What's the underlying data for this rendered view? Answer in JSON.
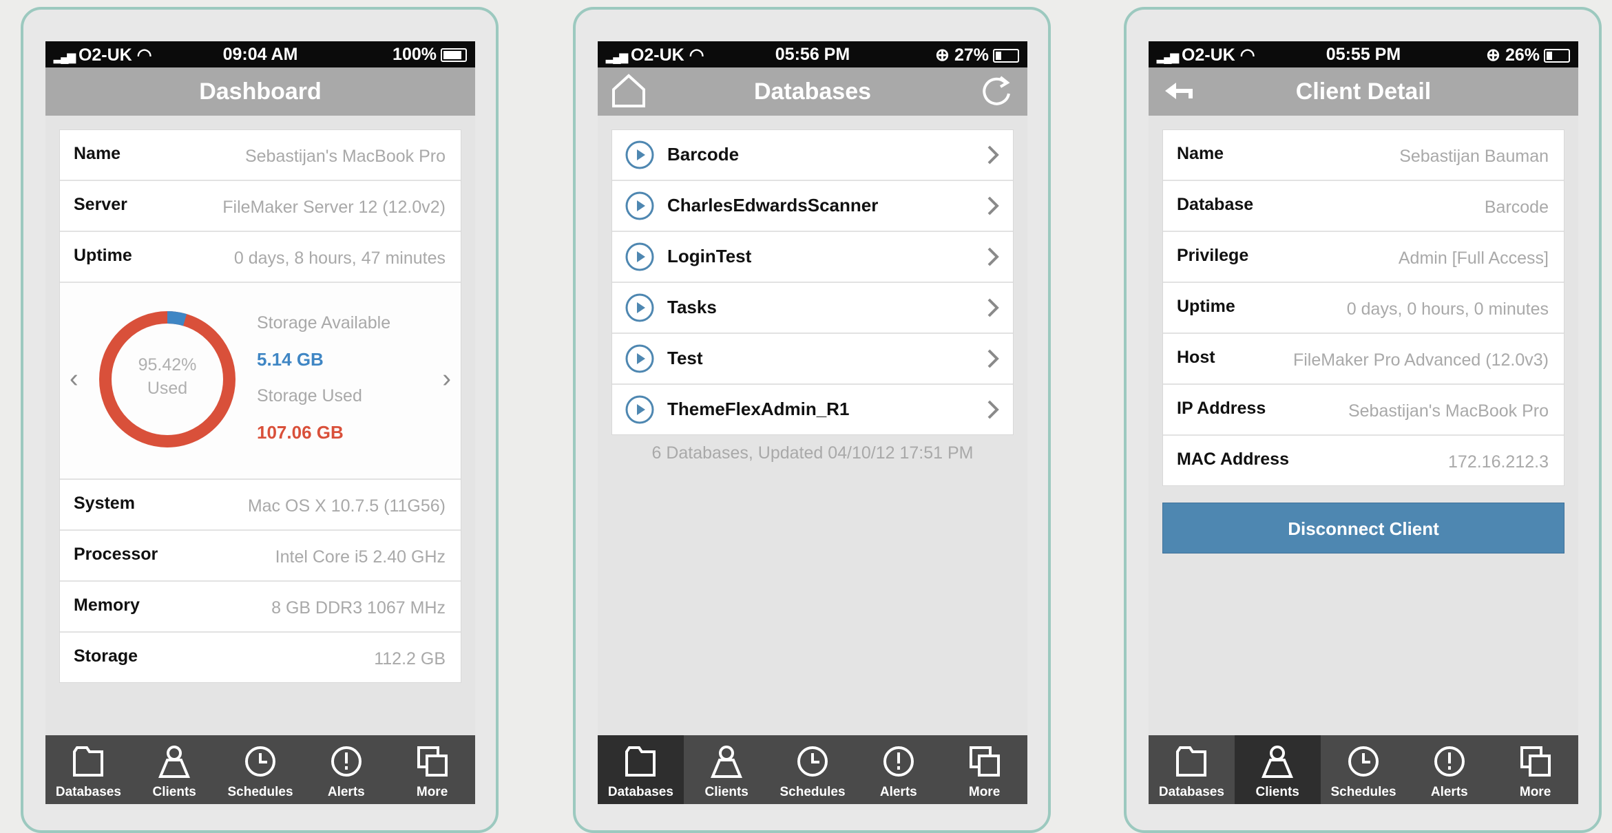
{
  "dashboard": {
    "status": {
      "carrier": "O2-UK",
      "time": "09:04 AM",
      "battery": "100%",
      "battery_level": 1.0
    },
    "title": "Dashboard",
    "rows_top": [
      {
        "key": "Name",
        "value": "Sebastijan's MacBook Pro"
      },
      {
        "key": "Server",
        "value": "FileMaker Server 12 (12.0v2)"
      },
      {
        "key": "Uptime",
        "value": "0 days, 8 hours, 47 minutes"
      }
    ],
    "storage": {
      "used_percent_text": "95.42%",
      "used_word": "Used",
      "used_fraction": 0.9542,
      "available_label": "Storage Available",
      "available_value": "5.14 GB",
      "used_label": "Storage Used",
      "used_value": "107.06 GB",
      "used_color": "#d9503a",
      "available_color": "#3f86c4"
    },
    "rows_bottom": [
      {
        "key": "System",
        "value": "Mac OS X 10.7.5 (11G56)"
      },
      {
        "key": "Processor",
        "value": "Intel Core i5 2.40 GHz"
      },
      {
        "key": "Memory",
        "value": "8 GB DDR3 1067 MHz"
      },
      {
        "key": "Storage",
        "value": "112.2 GB"
      }
    ]
  },
  "databases": {
    "status": {
      "carrier": "O2-UK",
      "time": "05:56 PM",
      "battery": "27%",
      "battery_level": 0.27
    },
    "title": "Databases",
    "items": [
      "Barcode",
      "CharlesEdwardsScanner",
      "LoginTest",
      "Tasks",
      "Test",
      "ThemeFlexAdmin_R1"
    ],
    "footnote": "6 Databases, Updated 04/10/12 17:51 PM"
  },
  "client": {
    "status": {
      "carrier": "O2-UK",
      "time": "05:55 PM",
      "battery": "26%",
      "battery_level": 0.26
    },
    "title": "Client Detail",
    "rows": [
      {
        "key": "Name",
        "value": "Sebastijan Bauman"
      },
      {
        "key": "Database",
        "value": "Barcode"
      },
      {
        "key": "Privilege",
        "value": "Admin [Full Access]"
      },
      {
        "key": "Uptime",
        "value": "0 days, 0 hours, 0 minutes"
      },
      {
        "key": "Host",
        "value": "FileMaker Pro Advanced (12.0v3)"
      },
      {
        "key": "IP Address",
        "value": "Sebastijan's MacBook Pro"
      },
      {
        "key": "MAC Address",
        "value": "172.16.212.3"
      }
    ],
    "button": "Disconnect Client"
  },
  "tabs": [
    "Databases",
    "Clients",
    "Schedules",
    "Alerts",
    "More"
  ]
}
